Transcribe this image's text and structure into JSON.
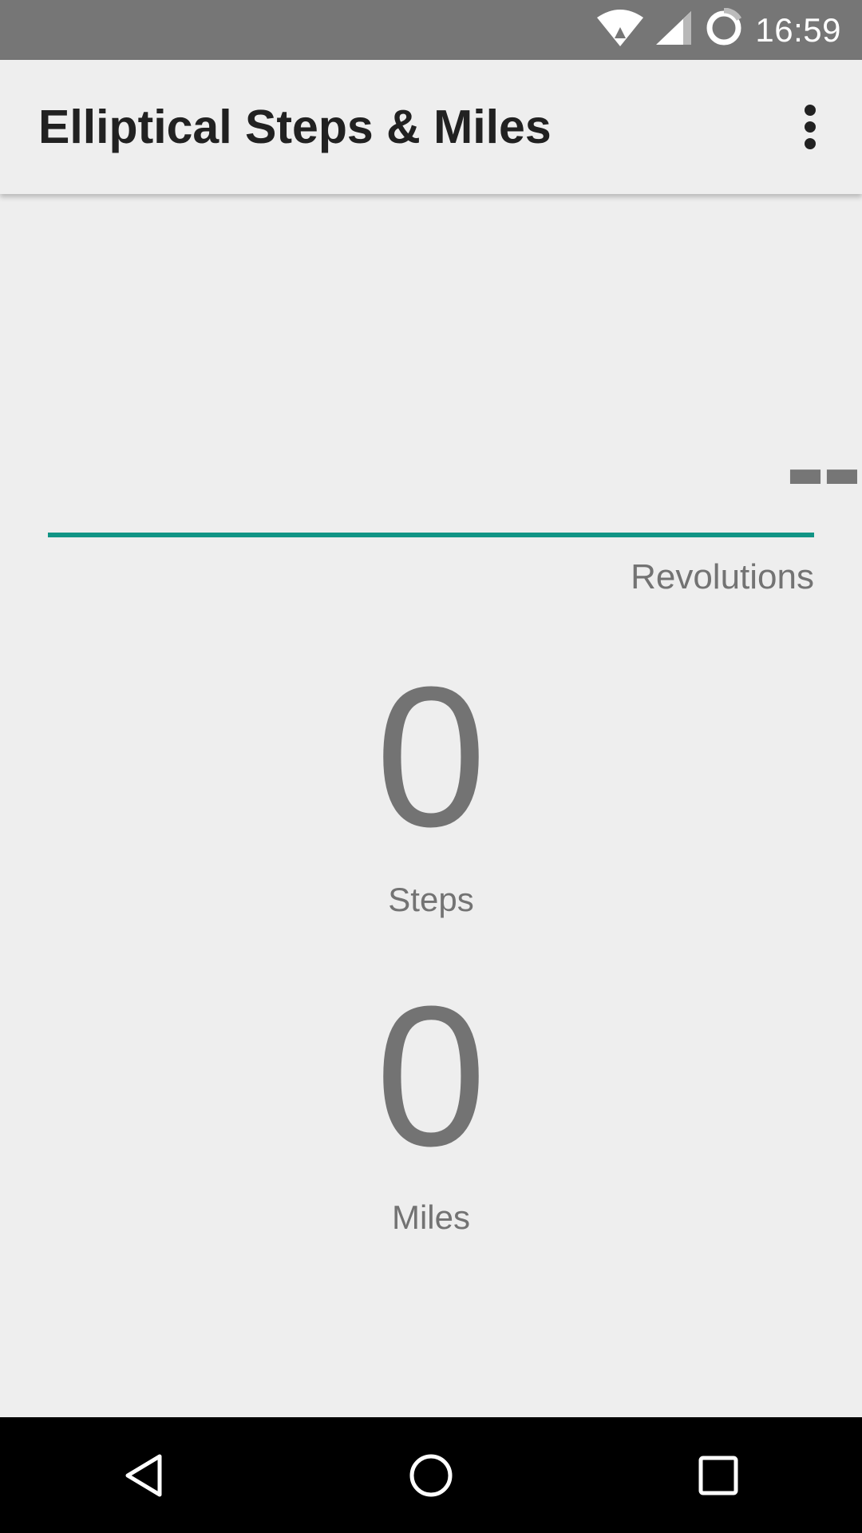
{
  "status_bar": {
    "time": "16:59",
    "icons": [
      "wifi-icon",
      "signal-icon",
      "sync-icon"
    ]
  },
  "app_bar": {
    "title": "Elliptical Steps & Miles",
    "overflow_icon": "more-vert-icon"
  },
  "revolutions": {
    "value": "--",
    "label": "Revolutions",
    "underline_color": "#119485"
  },
  "steps": {
    "value": "0",
    "label": "Steps"
  },
  "miles": {
    "value": "0",
    "label": "Miles"
  },
  "nav_bar": {
    "buttons": [
      "back-icon",
      "home-icon",
      "recents-icon"
    ]
  }
}
